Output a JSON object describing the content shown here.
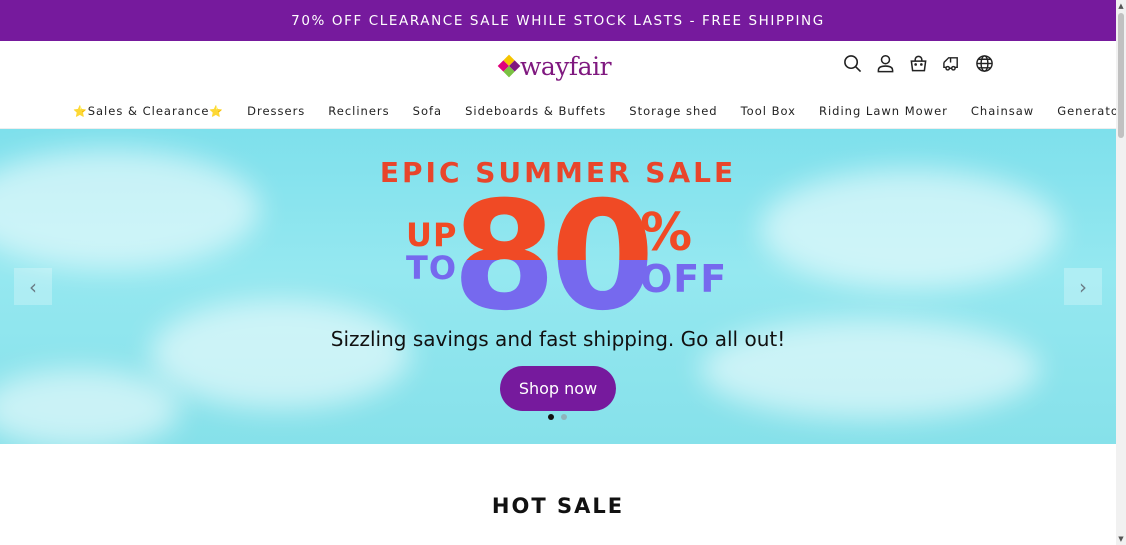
{
  "announcement": {
    "text": "70% OFF CLEARANCE SALE WHILE STOCK LASTS - FREE SHIPPING"
  },
  "brand": {
    "name": "wayfair",
    "tm": "·",
    "color": "#7f187f"
  },
  "header_icons": [
    "search-icon",
    "account-icon",
    "cart-icon",
    "track-order-icon",
    "globe-icon"
  ],
  "nav": {
    "items": [
      {
        "label": "Sales & Clearance",
        "star": "⭐"
      },
      {
        "label": "Dressers"
      },
      {
        "label": "Recliners"
      },
      {
        "label": "Sofa"
      },
      {
        "label": "Sideboards & Buffets"
      },
      {
        "label": "Storage shed"
      },
      {
        "label": "Tool Box"
      },
      {
        "label": "Riding Lawn Mower"
      },
      {
        "label": "Chainsaw"
      },
      {
        "label": "Generators"
      }
    ]
  },
  "hero": {
    "kicker": "EPIC SUMMER SALE",
    "up": "UP",
    "to": "TO",
    "number": "80",
    "percent": "%",
    "off": "OFF",
    "subtitle": "Sizzling savings and fast shipping. Go all out!",
    "cta": "Shop now",
    "prev": "‹",
    "next": "›",
    "slides": 2,
    "active_slide": 1
  },
  "section": {
    "title": "HOT SALE"
  },
  "colors": {
    "accent": "#761a9d",
    "sale_red": "#f04a25",
    "sale_blue": "#7669ee"
  }
}
